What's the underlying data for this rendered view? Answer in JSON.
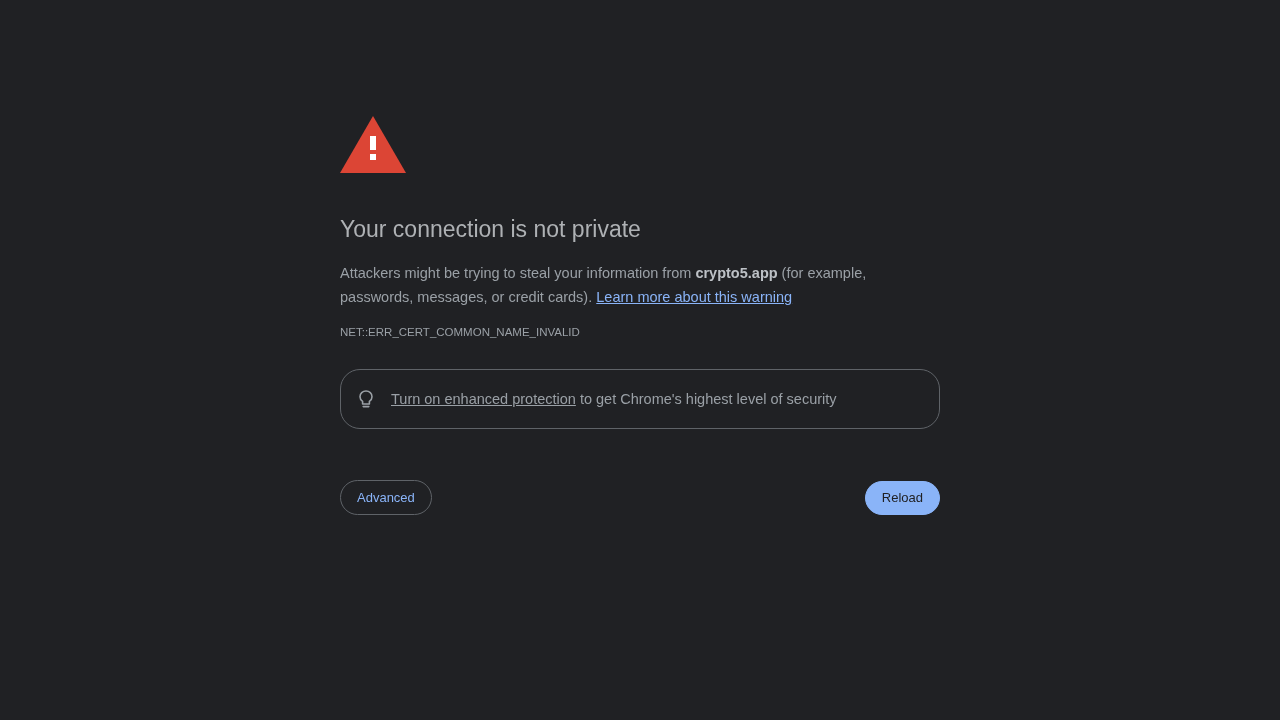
{
  "heading": "Your connection is not private",
  "explanation": {
    "text": "Attackers might be trying to steal your information from **crypto5.app** (for example, passwords, messages, or credit cards).",
    "link": "Learn more about this warning"
  },
  "error_code": "NET::ERR_CERT_COMMON_NAME_INVALID",
  "promo": {
    "link": "Turn on enhanced protection",
    "text": "to get Chrome's highest level of security"
  },
  "buttons": [
    {
      "label": "Advanced",
      "kind": "secondary"
    },
    {
      "label": "Reload",
      "kind": "primary"
    }
  ]
}
